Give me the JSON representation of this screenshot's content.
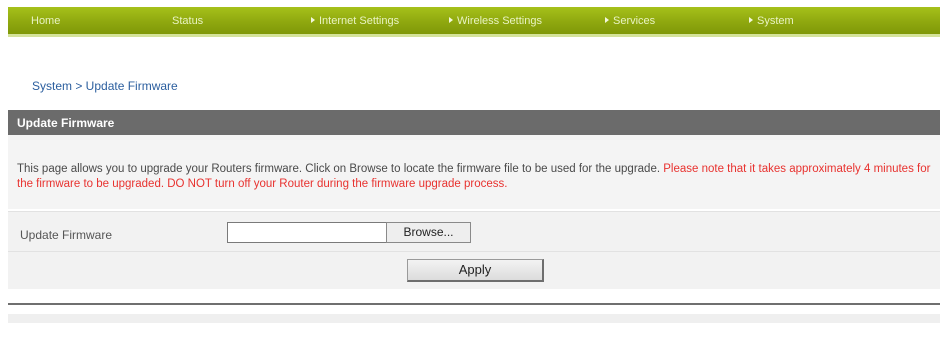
{
  "nav": {
    "items": [
      {
        "label": "Home",
        "has_arrow": false
      },
      {
        "label": "Status",
        "has_arrow": false
      },
      {
        "label": "Internet Settings",
        "has_arrow": true
      },
      {
        "label": "Wireless Settings",
        "has_arrow": true
      },
      {
        "label": "Services",
        "has_arrow": true
      },
      {
        "label": "System",
        "has_arrow": true
      }
    ],
    "bar_color": "#8fa80f"
  },
  "breadcrumb": "System > Update Firmware",
  "section": {
    "title": "Update Firmware"
  },
  "description": {
    "text": "This page allows you to upgrade your Routers firmware. Click on Browse to locate the firmware file to be used for the upgrade. ",
    "warning": "Please note that it takes approximately 4 minutes for the firmware to be upgraded. DO NOT turn off your Router during the firmware upgrade process.",
    "warning_color": "#e8322f"
  },
  "form": {
    "field_label": "Update Firmware",
    "file_value": "",
    "browse_label": "Browse...",
    "apply_label": "Apply"
  }
}
